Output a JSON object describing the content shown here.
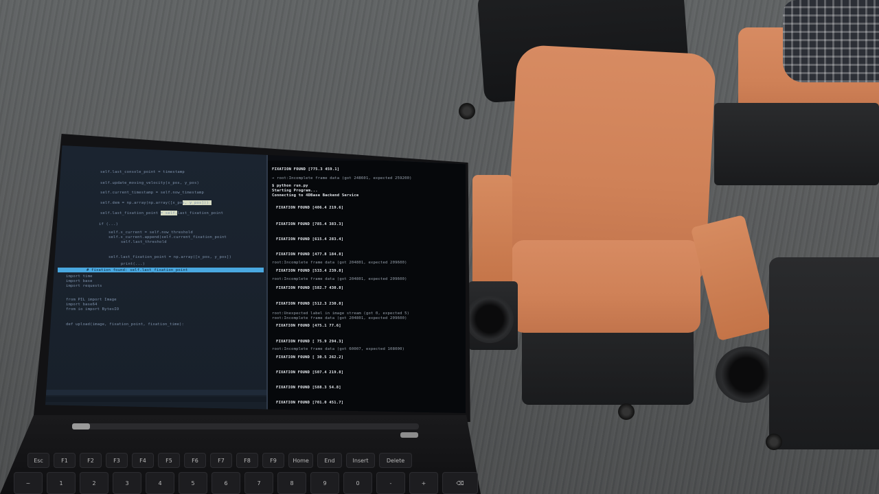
{
  "scene": {
    "description_colors": {
      "floor": "#5a5c5c",
      "seat": "#d48a5e",
      "chair_frame": "#1a1b1d",
      "laptop": "#121214"
    },
    "left_editor_lines": [
      "self.last_console_point = timestamp",
      "self.update_moving_velocity(x_pos, y_pos)",
      "self.current_timestamp = self.now_timestamp",
      "self.dem = np.array(np.array([x_pos, y_pos]))",
      "self.last_fixation_point = self.last_fixation_point",
      "if (...)",
      "self.x_current = self.now_threshold",
      "self.x_current.append(self.current_fixation_point",
      "self.last_threshold",
      "self.last_fixation_point = np.array([x_pos, y_pos])",
      "print(...)",
      "# fixation found: self.last_fixation_point",
      "import time",
      "import base",
      "import requests",
      "from PIL import Image",
      "import base64",
      "from io import BytesIO",
      "def upload(image, fixation_point, fixation_time):"
    ],
    "terminal_lines": [
      "FIXATION FOUND [775.3 459.1]",
      "→ root:Incomplete frame data (got 248601, expected 259200)",
      "$ python run.py",
      "Starting Program...",
      "Connecting to 4DBase Backend Service",
      "FIXATION FOUND [406.4 219.6]",
      "FIXATION FOUND [785.4 383.3]",
      "FIXATION FOUND [615.4 283.4]",
      "FIXATION FOUND [477.8 184.8]",
      "root:Incomplete frame data (got 204801, expected 209600)",
      "FIXATION FOUND [533.4 239.8]",
      "root:Incomplete frame data (got 204801, expected 209600)",
      "FIXATION FOUND [582.7 430.8]",
      "FIXATION FOUND [512.3 230.8]",
      "root:Unexpected label in image stream (got 0, expected 5)",
      "root:Incomplete frame data (got 204801, expected 209600)",
      "FIXATION FOUND [475.1 77.6]",
      "FIXATION FOUND [ 75.9 294.3]",
      "root:Incomplete frame data (got 60007, expected 108000)",
      "FIXATION FOUND [ 30.5 262.2]",
      "FIXATION FOUND [507.4 219.8]",
      "FIXATION FOUND [588.3 54.8]",
      "FIXATION FOUND [701.0 451.7]"
    ],
    "keyboard_top_row": [
      "Esc",
      "F1",
      "F2",
      "F3",
      "F4",
      "F5",
      "F6",
      "F7",
      "F8",
      "F9",
      "Home",
      "End",
      "Insert",
      "Delete"
    ],
    "keyboard_num_row": [
      "~",
      "1",
      "2",
      "3",
      "4",
      "5",
      "6",
      "7",
      "8",
      "9",
      "0",
      "-",
      "+",
      "⌫"
    ]
  }
}
